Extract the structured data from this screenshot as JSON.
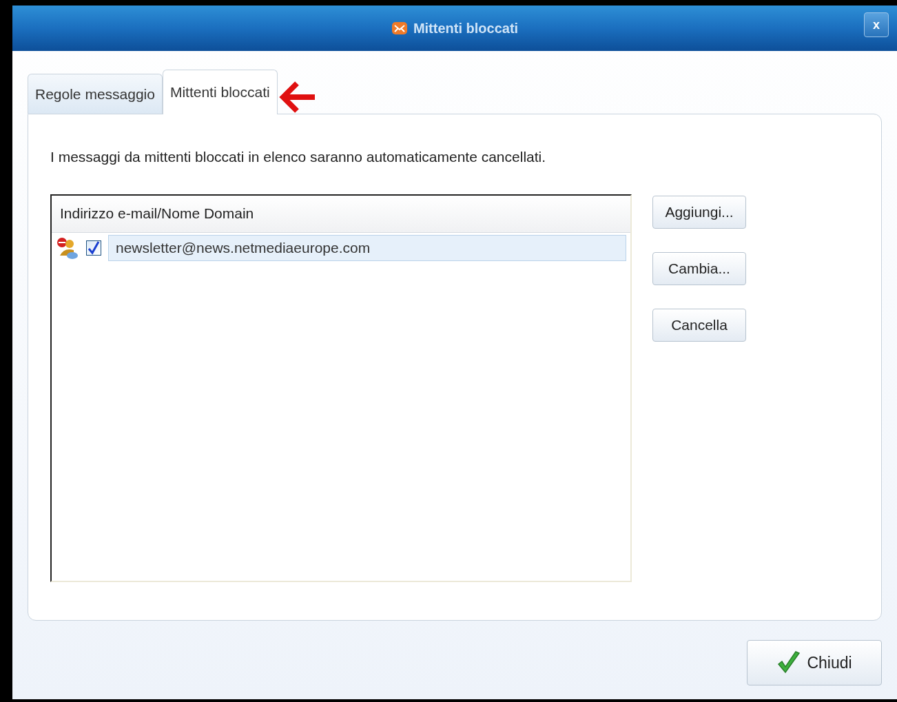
{
  "window": {
    "title": "Mittenti bloccati",
    "close": "x"
  },
  "tabs": [
    {
      "label": "Regole messaggio",
      "selected": false
    },
    {
      "label": "Mittenti bloccati",
      "selected": true
    }
  ],
  "description": "I messaggi da mittenti bloccati in elenco  saranno automaticamente cancellati.",
  "list": {
    "column": "Indirizzo e-mail/Nome Domain",
    "rows": [
      {
        "address": "newsletter@news.netmediaeurope.com",
        "checked": true,
        "selected": true
      }
    ]
  },
  "buttons": [
    "Aggiungi...",
    "Cambia...",
    "Cancella"
  ],
  "close_button": "Chiudi"
}
